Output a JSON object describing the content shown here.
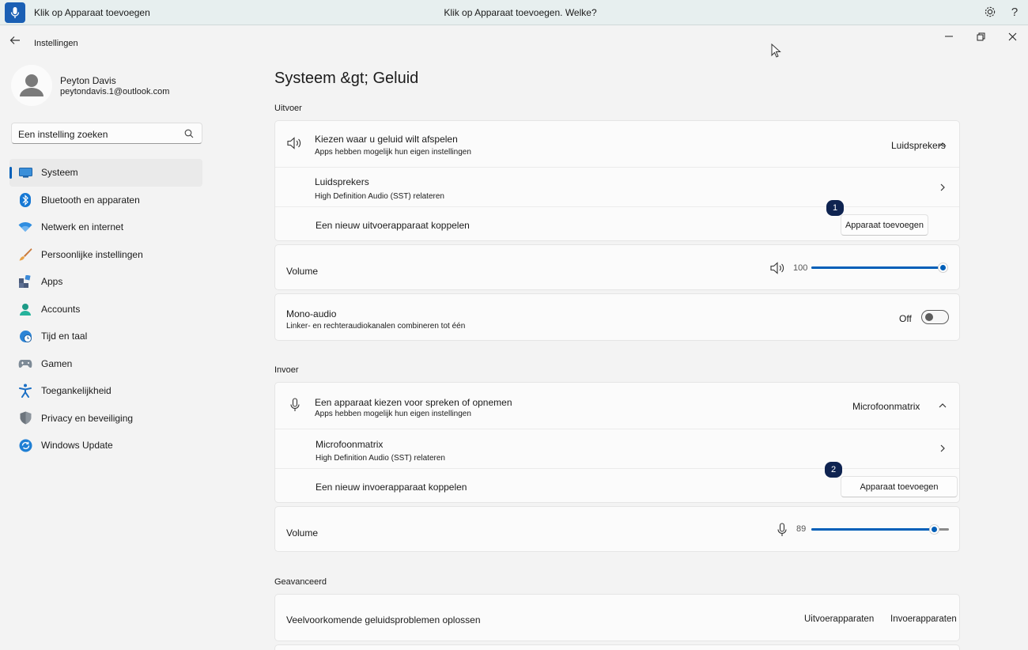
{
  "voice_access": {
    "status_text": "Klik op Apparaat toevoegen",
    "message": "Klik op Apparaat toevoegen. Welke?",
    "help_glyph": "?"
  },
  "window": {
    "title": "Instellingen"
  },
  "profile": {
    "name": "Peyton Davis",
    "email": "peytondavis.1@outlook.com"
  },
  "search": {
    "placeholder": "Een instelling zoeken"
  },
  "nav": {
    "items": [
      {
        "label": "Systeem",
        "icon": "system-icon",
        "active": true
      },
      {
        "label": "Bluetooth en apparaten",
        "icon": "bluetooth-icon"
      },
      {
        "label": "Netwerk en internet",
        "icon": "wifi-icon"
      },
      {
        "label": "Persoonlijke instellingen",
        "icon": "brush-icon"
      },
      {
        "label": "Apps",
        "icon": "apps-icon"
      },
      {
        "label": "Accounts",
        "icon": "person-icon"
      },
      {
        "label": "Tijd en taal",
        "icon": "clock-globe-icon"
      },
      {
        "label": "Gamen",
        "icon": "gamepad-icon"
      },
      {
        "label": "Toegankelijkheid",
        "icon": "accessibility-icon"
      },
      {
        "label": "Privacy en beveiliging",
        "icon": "shield-icon"
      },
      {
        "label": "Windows Update",
        "icon": "update-icon"
      }
    ]
  },
  "page": {
    "title": "Systeem &gt;  Geluid"
  },
  "output": {
    "heading": "Uitvoer",
    "choose_title": "Kiezen waar u geluid wilt afspelen",
    "choose_sub": "Apps hebben mogelijk hun eigen instellingen",
    "selected_device": "Luidsprekers",
    "device_name": "Luidsprekers",
    "device_sub": "High Definition Audio (SST) relateren",
    "pair_label": "Een nieuw uitvoerapparaat koppelen",
    "add_button": "Apparaat toevoegen",
    "badge": "1",
    "volume_label": "Volume",
    "volume_value": "100",
    "volume_level": 100,
    "mono_title": "Mono-audio",
    "mono_sub": "Linker- en rechteraudiokanalen combineren tot één",
    "mono_state": "Off"
  },
  "input": {
    "heading": "Invoer",
    "choose_title": "Een apparaat kiezen voor spreken of opnemen",
    "choose_sub": "Apps hebben mogelijk hun eigen instellingen",
    "selected_device": "Microfoonmatrix",
    "device_name": "Microfoonmatrix",
    "device_sub": "High Definition Audio (SST) relateren",
    "pair_label": "Een nieuw invoerapparaat koppelen",
    "add_button": "Apparaat toevoegen",
    "badge": "2",
    "volume_label": "Volume",
    "volume_value": "89",
    "volume_level": 89
  },
  "advanced": {
    "heading": "Geavanceerd",
    "troubleshoot_label": "Veelvoorkomende geluidsproblemen oplossen",
    "output_link": "Uitvoerapparaten",
    "input_link": "Invoerapparaten"
  },
  "colors": {
    "accent": "#005fb8",
    "badge": "#0f2451",
    "mic_button": "#1a5fb4"
  }
}
